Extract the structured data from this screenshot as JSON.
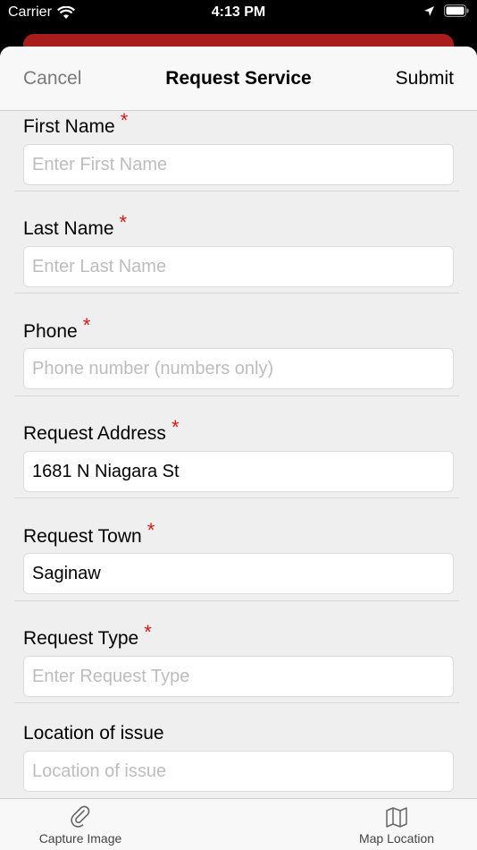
{
  "status": {
    "carrier": "Carrier",
    "time": "4:13 PM"
  },
  "nav": {
    "cancel": "Cancel",
    "title": "Request Service",
    "submit": "Submit"
  },
  "fields": [
    {
      "label": "First Name",
      "required": "*",
      "value": "",
      "placeholder": "Enter First Name"
    },
    {
      "label": "Last Name",
      "required": "*",
      "value": "",
      "placeholder": "Enter Last Name"
    },
    {
      "label": "Phone",
      "required": "*",
      "value": "",
      "placeholder": "Phone number (numbers only)"
    },
    {
      "label": "Request Address",
      "required": "*",
      "value": "1681 N Niagara St",
      "placeholder": ""
    },
    {
      "label": "Request Town",
      "required": "*",
      "value": "Saginaw",
      "placeholder": ""
    },
    {
      "label": "Request Type",
      "required": "*",
      "value": "",
      "placeholder": "Enter Request Type"
    },
    {
      "label": "Location of issue",
      "value": "",
      "placeholder": "Location of issue"
    }
  ],
  "tabs": {
    "capture_image": "Capture Image",
    "map_location": "Map Location"
  },
  "icons": {
    "capture": "paperclip-icon",
    "map": "map-icon"
  },
  "colors": {
    "required": "#e01414",
    "header_banner": "#a81c1c",
    "sheet_bg": "#efefef"
  }
}
